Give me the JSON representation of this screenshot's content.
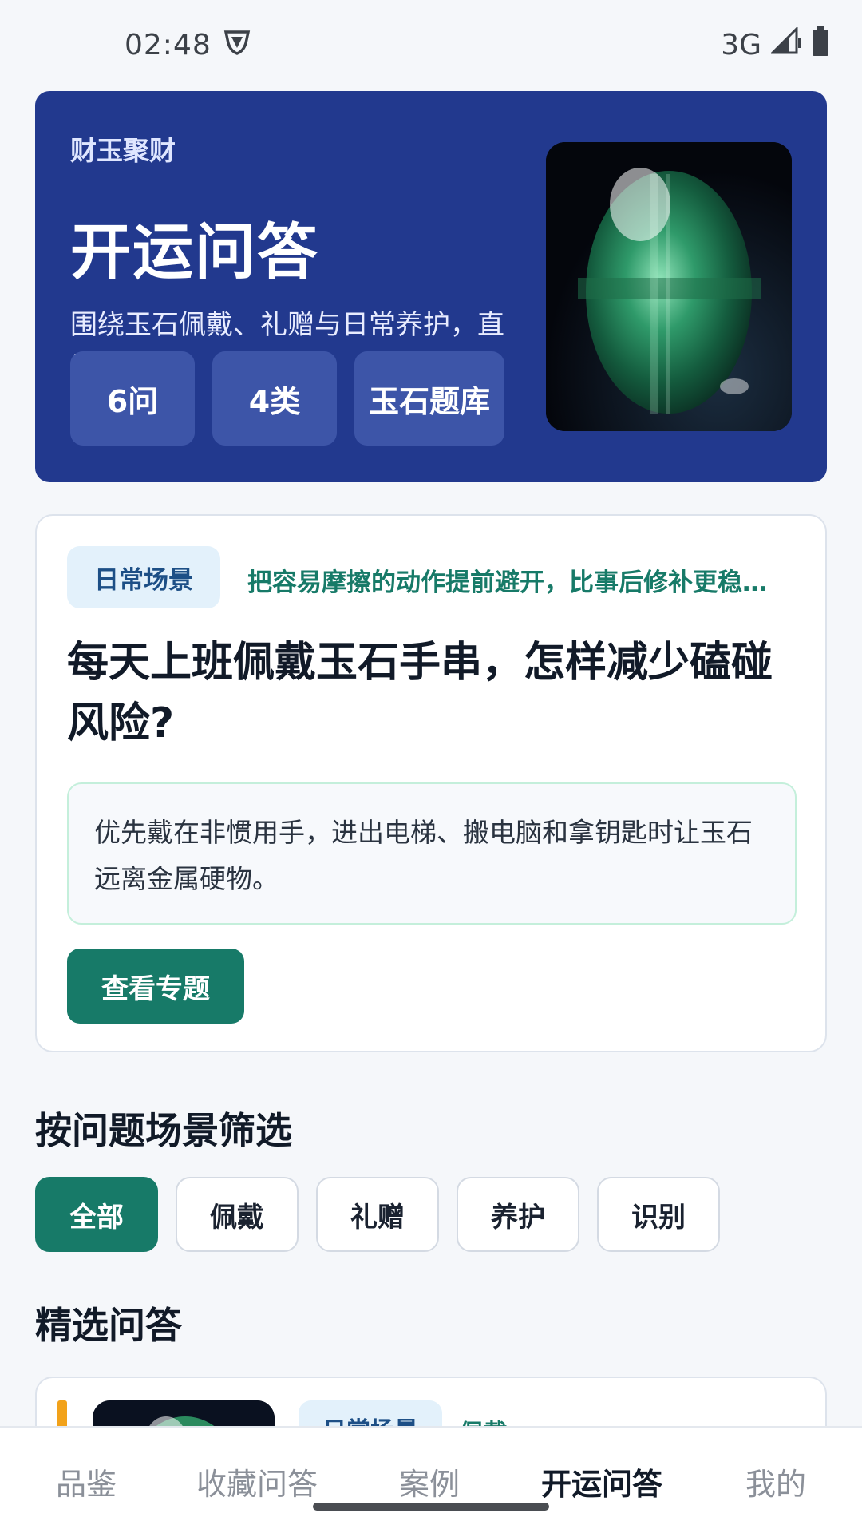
{
  "status_bar": {
    "time": "02:48",
    "network": "3G",
    "icons": [
      "vpn-shield-icon",
      "signal-icon",
      "battery-icon"
    ]
  },
  "hero": {
    "brand": "财玉聚财",
    "title": "开运问答",
    "description": "围绕玉石佩戴、礼赠与日常养护，直接…",
    "tags": [
      "6问",
      "4类",
      "玉石题库"
    ],
    "image_icon": "jade-cabochon-image"
  },
  "featured": {
    "scene_label": "日常场景",
    "tip": "把容易摩擦的动作提前避开，比事后修补更稳…",
    "question": "每天上班佩戴玉石手串，怎样减少磕碰风险?",
    "answer": "优先戴在非惯用手，进出电梯、搬电脑和拿钥匙时让玉石远离金属硬物。",
    "button_label": "查看专题"
  },
  "filter": {
    "title": "按问题场景筛选",
    "chips": [
      "全部",
      "佩戴",
      "礼赠",
      "养护",
      "识别"
    ],
    "active_index": 0
  },
  "selected": {
    "title": "精选问答",
    "items": [
      {
        "scene_label": "日常场景",
        "category": "佩戴"
      }
    ]
  },
  "bottom_nav": {
    "items": [
      "品鉴",
      "收藏问答",
      "案例",
      "开运问答",
      "我的"
    ],
    "active_index": 3
  },
  "colors": {
    "hero_bg": "#22398e",
    "accent_green": "#177a68",
    "badge_bg": "#e3f1fb",
    "highlight_orange": "#f2a21a"
  }
}
